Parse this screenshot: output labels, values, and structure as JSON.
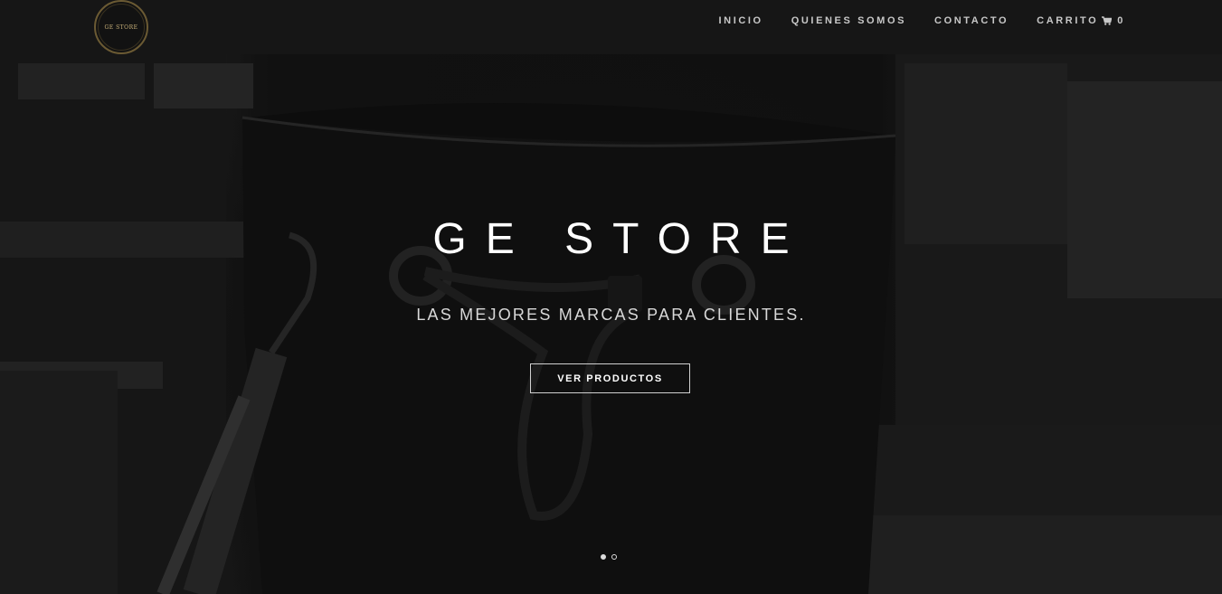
{
  "header": {
    "logo_text": "GE STORE",
    "nav": [
      {
        "label": "INICIO"
      },
      {
        "label": "QUIENES SOMOS"
      },
      {
        "label": "CONTACTO"
      },
      {
        "label": "CARRITO",
        "icon": "cart-icon",
        "count": "0"
      }
    ]
  },
  "hero": {
    "title": "GE STORE",
    "subtitle": "LAS MEJORES MARCAS PARA CLIENTES.",
    "cta_label": "VER PRODUCTOS",
    "slides": 2,
    "active_slide": 1
  },
  "colors": {
    "background": "#151515",
    "header": "#161616",
    "logo_gold": "#c9b27a",
    "text": "#ffffff"
  }
}
